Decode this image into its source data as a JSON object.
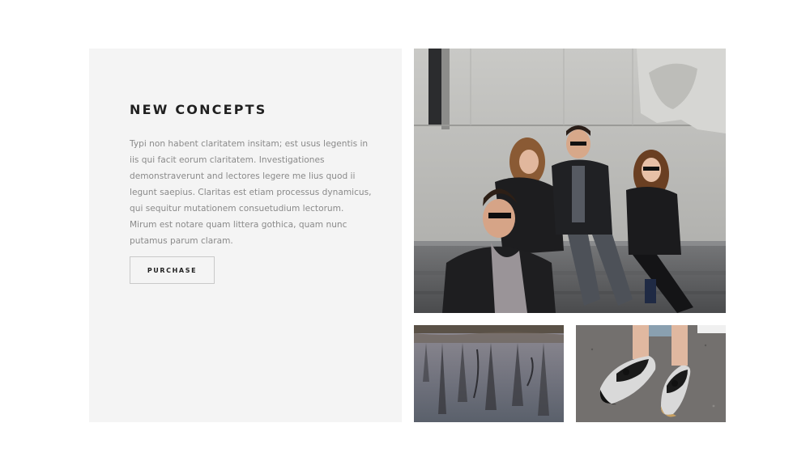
{
  "feature": {
    "title": "NEW CONCEPTS",
    "body": "Typi non habent claritatem insitam; est usus legentis in iis qui facit eorum claritatem. Investigationes demonstraverunt and lectores legere me lius quod ii legunt saepius. Claritas est etiam processus dynamicus, qui sequitur mutationem consuetudium lectorum. Mirum est notare quam littera gothica, quam nunc putamus parum claram.",
    "button_label": "PURCHASE"
  },
  "gallery": {
    "images": [
      {
        "name": "group-photo",
        "description_icon": "people-on-steps-image"
      },
      {
        "name": "water-reflection-photo",
        "description_icon": "lake-reflection-image"
      },
      {
        "name": "shoes-photo",
        "description_icon": "loafers-image"
      }
    ]
  },
  "colors": {
    "panel_background": "#f4f4f4",
    "title": "#1f1f1f",
    "body_text": "#8a8a8a",
    "button_border": "#c9c9c9"
  }
}
